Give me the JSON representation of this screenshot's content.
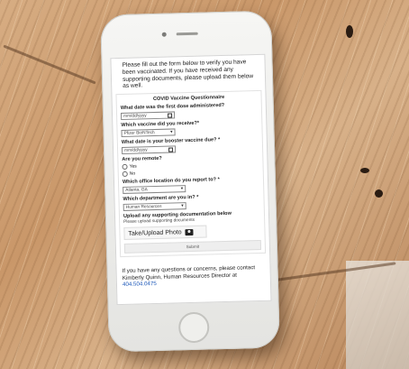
{
  "intro": {
    "text": "Please fill out the form below to verify you have been vaccinated. If you have received any supporting documents, please upload them below as well."
  },
  "form": {
    "title": "COVID Vaccine Questionnaire",
    "q1": {
      "label": "What date was the first dose administered?",
      "placeholder": "mm/dd/yyyy"
    },
    "q2": {
      "label": "Which vaccine did you receive?*",
      "value": "Pfizer BioNTech"
    },
    "q3": {
      "label": "What date is your booster vaccine due? *",
      "placeholder": "mm/dd/yyyy"
    },
    "q4": {
      "label": "Are you remote?",
      "options": [
        "Yes",
        "No"
      ]
    },
    "q5": {
      "label": "Which office location do you report to? *",
      "value": "Atlanta, GA"
    },
    "q6": {
      "label": "Which department are you in? *",
      "value": "Human Resources"
    },
    "upload": {
      "label": "Upload any supporting documentation below",
      "help": "Please upload supporting documents",
      "button": "Take/Upload Photo"
    },
    "submit": "Submit"
  },
  "contact": {
    "text": "If you have any questions or concerns, please contact Kimberly Quinn, Human Resources Director at",
    "phone": "404.504.0475"
  },
  "colors": {
    "link": "#1a56b8",
    "wood": "#c99769"
  },
  "icons": [
    "calendar-icon",
    "camera-icon",
    "chevron-down-icon"
  ]
}
